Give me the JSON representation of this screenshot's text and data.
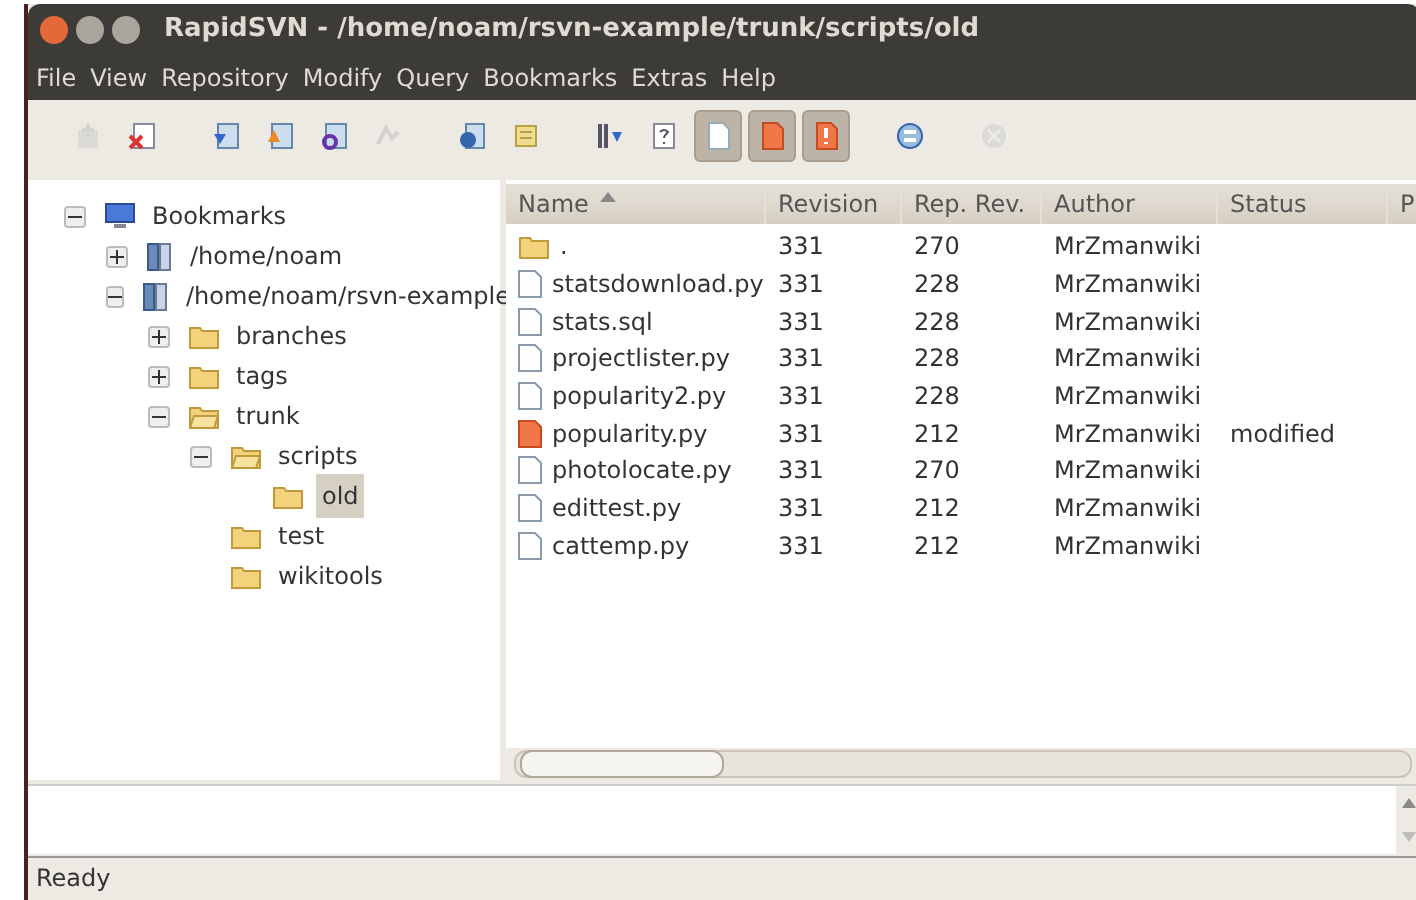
{
  "window": {
    "title": "RapidSVN - /home/noam/rsvn-example/trunk/scripts/old"
  },
  "menu": [
    "File",
    "View",
    "Repository",
    "Modify",
    "Query",
    "Bookmarks",
    "Extras",
    "Help"
  ],
  "toolbar": [
    {
      "disabled": true,
      "pressed": false
    },
    {
      "disabled": false,
      "pressed": false
    },
    {
      "disabled": false,
      "pressed": false
    },
    {
      "disabled": false,
      "pressed": false
    },
    {
      "disabled": false,
      "pressed": false
    },
    {
      "disabled": true,
      "pressed": false
    },
    {
      "disabled": false,
      "pressed": false
    },
    {
      "disabled": false,
      "pressed": false
    },
    {
      "disabled": false,
      "pressed": false
    },
    {
      "disabled": false,
      "pressed": false
    },
    {
      "disabled": false,
      "pressed": true
    },
    {
      "disabled": false,
      "pressed": true
    },
    {
      "disabled": false,
      "pressed": true
    },
    {
      "disabled": false,
      "pressed": false
    },
    {
      "disabled": true,
      "pressed": false
    }
  ],
  "tree": [
    {
      "label": "Bookmarks",
      "kind": "bookmarks",
      "expanded": true,
      "selected": false,
      "children": [
        {
          "label": "/home/noam",
          "kind": "repository",
          "expanded": false,
          "selected": false
        },
        {
          "label": "/home/noam/rsvn-example",
          "kind": "repository",
          "expanded": true,
          "selected": false,
          "children": [
            {
              "label": "branches",
              "kind": "folder",
              "expanded": false,
              "selected": false
            },
            {
              "label": "tags",
              "kind": "folder",
              "expanded": false,
              "selected": false
            },
            {
              "label": "trunk",
              "kind": "folder",
              "expanded": true,
              "selected": false,
              "children": [
                {
                  "label": "scripts",
                  "kind": "folder",
                  "expanded": true,
                  "selected": false,
                  "children": [
                    {
                      "label": "old",
                      "kind": "folder",
                      "selected": true
                    }
                  ]
                },
                {
                  "label": "test",
                  "kind": "folder",
                  "selected": false
                },
                {
                  "label": "wikitools",
                  "kind": "folder",
                  "selected": false
                }
              ]
            }
          ]
        }
      ]
    }
  ],
  "table": {
    "columns": [
      {
        "label": "Name",
        "sorted": true
      },
      {
        "label": "Revision",
        "sorted": false
      },
      {
        "label": "Rep. Rev.",
        "sorted": false
      },
      {
        "label": "Author",
        "sorted": false
      },
      {
        "label": "Status",
        "sorted": false
      },
      {
        "label": "P",
        "sorted": false
      }
    ],
    "rows": [
      {
        "kind": "folder",
        "cells": [
          ".",
          "331",
          "270",
          "MrZmanwiki",
          ""
        ]
      },
      {
        "kind": "file",
        "cells": [
          "statsdownload.py",
          "331",
          "228",
          "MrZmanwiki",
          ""
        ]
      },
      {
        "kind": "file",
        "cells": [
          "stats.sql",
          "331",
          "228",
          "MrZmanwiki",
          ""
        ]
      },
      {
        "kind": "file",
        "cells": [
          "projectlister.py",
          "331",
          "228",
          "MrZmanwiki",
          ""
        ]
      },
      {
        "kind": "file",
        "cells": [
          "popularity2.py",
          "331",
          "228",
          "MrZmanwiki",
          ""
        ]
      },
      {
        "kind": "modified",
        "cells": [
          "popularity.py",
          "331",
          "212",
          "MrZmanwiki",
          "modified"
        ]
      },
      {
        "kind": "file",
        "cells": [
          "photolocate.py",
          "331",
          "270",
          "MrZmanwiki",
          ""
        ]
      },
      {
        "kind": "file",
        "cells": [
          "edittest.py",
          "331",
          "212",
          "MrZmanwiki",
          ""
        ]
      },
      {
        "kind": "file",
        "cells": [
          "cattemp.py",
          "331",
          "212",
          "MrZmanwiki",
          ""
        ]
      }
    ]
  },
  "status_bar": "Ready"
}
